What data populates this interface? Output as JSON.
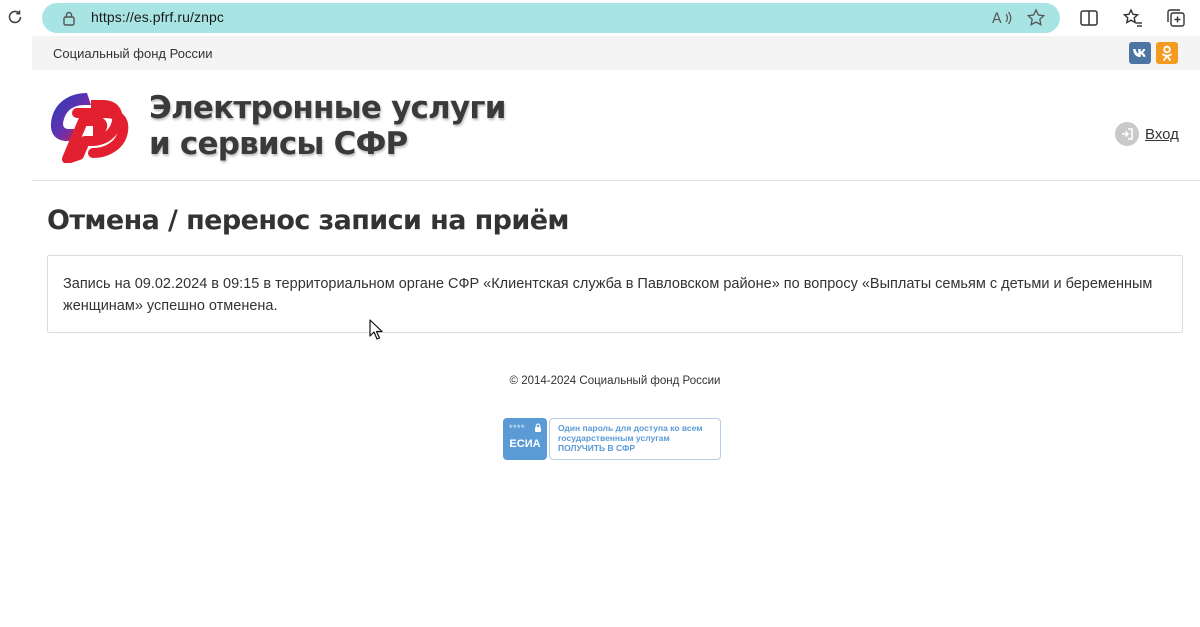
{
  "browser": {
    "url": "https://es.pfrf.ru/znpc",
    "address_bar_color": "#a8e4e4"
  },
  "topline": {
    "org_name": "Социальный фонд России",
    "social": [
      {
        "name": "vk",
        "label": "vk",
        "color": "#4c75a3"
      },
      {
        "name": "ok",
        "label": "ok",
        "color": "#f59a20"
      }
    ]
  },
  "header": {
    "title_line1": "Электронные услуги",
    "title_line2": "и сервисы СФР",
    "login_label": "Вход"
  },
  "content": {
    "page_title": "Отмена / перенос записи на приём",
    "message": "Запись на 09.02.2024 в 09:15 в территориальном органе СФР «Клиентская служба в Павловском районе» по вопросу «Выплаты семьям с детьми и беременным женщинам» успешно отменена."
  },
  "footer": {
    "copyright": "© 2014-2024 Социальный фонд России",
    "esia": {
      "stars": "****",
      "badge": "ЕСИА",
      "line1": "Один пароль для доступа ко всем",
      "line2": "государственным услугам",
      "line3": "ПОЛУЧИТЬ В СФР"
    }
  },
  "colors": {
    "logo_blue": "#1f3fb5",
    "logo_red": "#e3202f",
    "esia_blue": "#5b9bd5"
  }
}
